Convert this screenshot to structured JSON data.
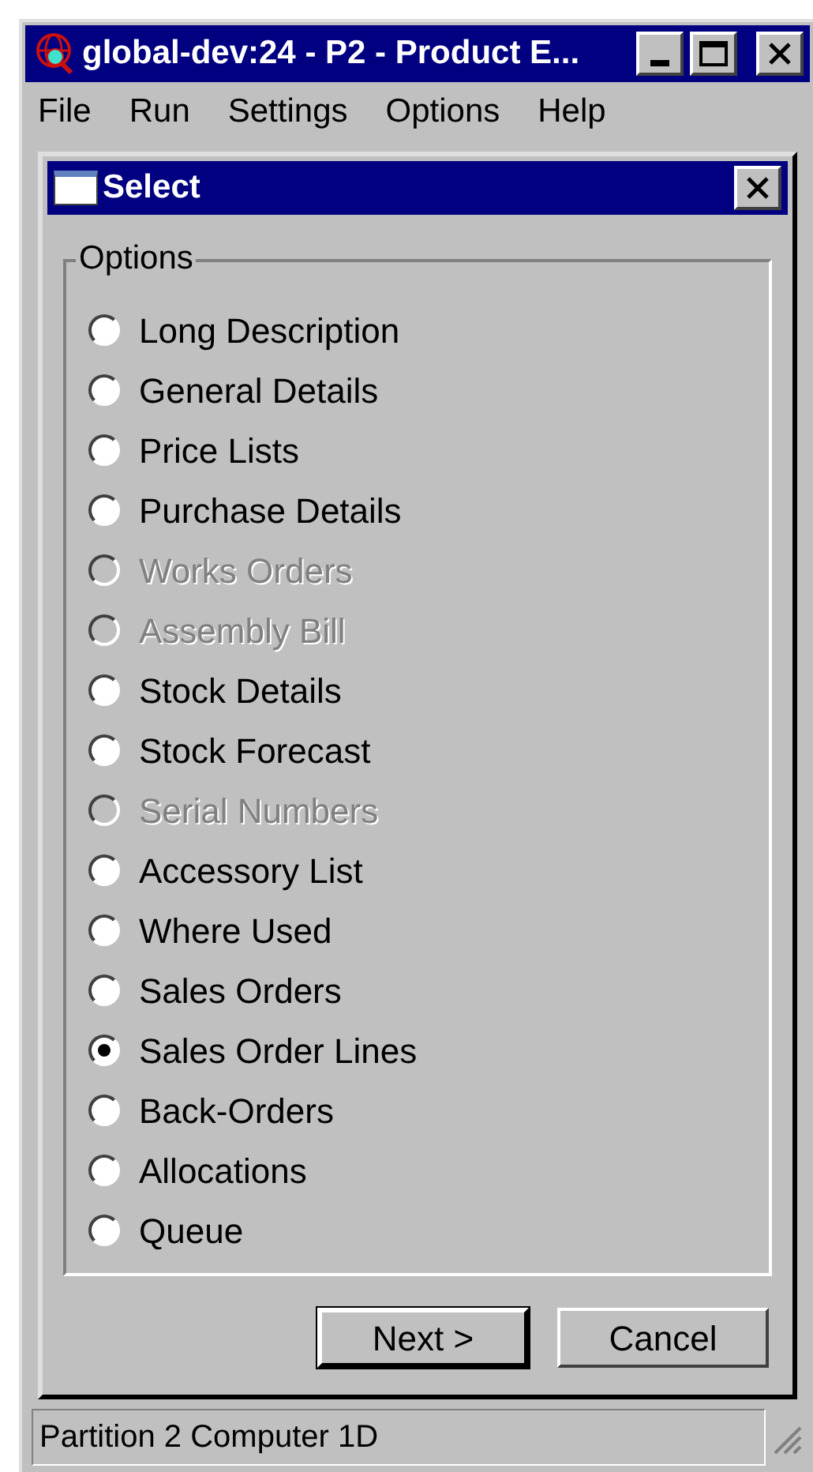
{
  "window": {
    "title": "global-dev:24 - P2 - Product E..."
  },
  "menu": [
    "File",
    "Run",
    "Settings",
    "Options",
    "Help"
  ],
  "dialog": {
    "title": "Select",
    "group_label": "Options",
    "options": [
      {
        "label": "Long Description",
        "selected": false,
        "disabled": false
      },
      {
        "label": "General Details",
        "selected": false,
        "disabled": false
      },
      {
        "label": "Price Lists",
        "selected": false,
        "disabled": false
      },
      {
        "label": "Purchase Details",
        "selected": false,
        "disabled": false
      },
      {
        "label": "Works Orders",
        "selected": false,
        "disabled": true
      },
      {
        "label": "Assembly Bill",
        "selected": false,
        "disabled": true
      },
      {
        "label": "Stock Details",
        "selected": false,
        "disabled": false
      },
      {
        "label": "Stock Forecast",
        "selected": false,
        "disabled": false
      },
      {
        "label": "Serial Numbers",
        "selected": false,
        "disabled": true
      },
      {
        "label": "Accessory List",
        "selected": false,
        "disabled": false
      },
      {
        "label": "Where Used",
        "selected": false,
        "disabled": false
      },
      {
        "label": "Sales Orders",
        "selected": false,
        "disabled": false
      },
      {
        "label": "Sales Order Lines",
        "selected": true,
        "disabled": false
      },
      {
        "label": "Back-Orders",
        "selected": false,
        "disabled": false
      },
      {
        "label": "Allocations",
        "selected": false,
        "disabled": false
      },
      {
        "label": "Queue",
        "selected": false,
        "disabled": false
      }
    ],
    "buttons": [
      {
        "label": "Next >",
        "default": true
      },
      {
        "label": "Cancel",
        "default": false
      }
    ]
  },
  "status_bar": "Partition 2 Computer 1D"
}
